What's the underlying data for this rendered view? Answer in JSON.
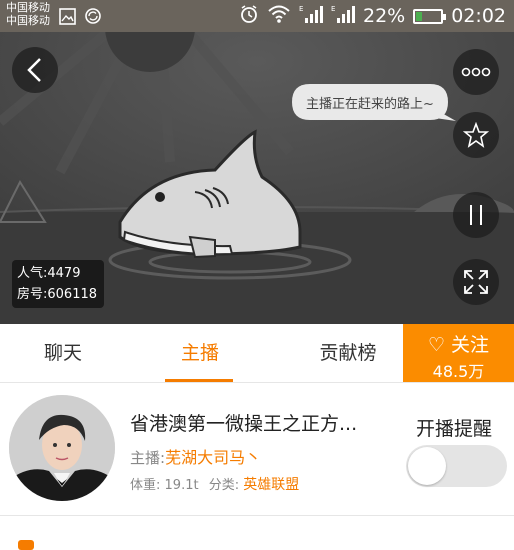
{
  "status_bar": {
    "carrier_1": "中国移动",
    "carrier_2": "中国移动",
    "battery": "22%",
    "time": "02:02",
    "icons": [
      "image-icon",
      "sync-icon",
      "alarm-icon",
      "wifi-icon",
      "signal-icon",
      "signal-icon",
      "battery-charging-icon"
    ]
  },
  "video": {
    "speech_bubble": "主播正在赶来的路上~",
    "popularity": "人气:4479",
    "room_number": "房号:606118",
    "buttons": [
      "back-icon",
      "more-icon",
      "favorite-icon",
      "pause-icon",
      "fullscreen-icon"
    ]
  },
  "tabs": [
    {
      "label": "聊天",
      "active": false
    },
    {
      "label": "主播",
      "active": true
    },
    {
      "label": "贡献榜",
      "active": false
    }
  ],
  "follow": {
    "label": "♡ 关注",
    "count": "48.5万"
  },
  "anchor": {
    "room_title": "省港澳第一微操王之正方...",
    "anchor_prefix": "主播:",
    "anchor_name": "芜湖大司马丶",
    "weight_label": "体重:",
    "weight_value": "19.1t",
    "category_label": "分类:",
    "category_value": "英雄联盟",
    "remind_label": "开播提醒",
    "remind_on": false
  },
  "colors": {
    "accent": "#f57c00",
    "follow_bg": "#fb8c00",
    "status_bar": "#6a645c",
    "video_bg": "#4a4a4a"
  }
}
